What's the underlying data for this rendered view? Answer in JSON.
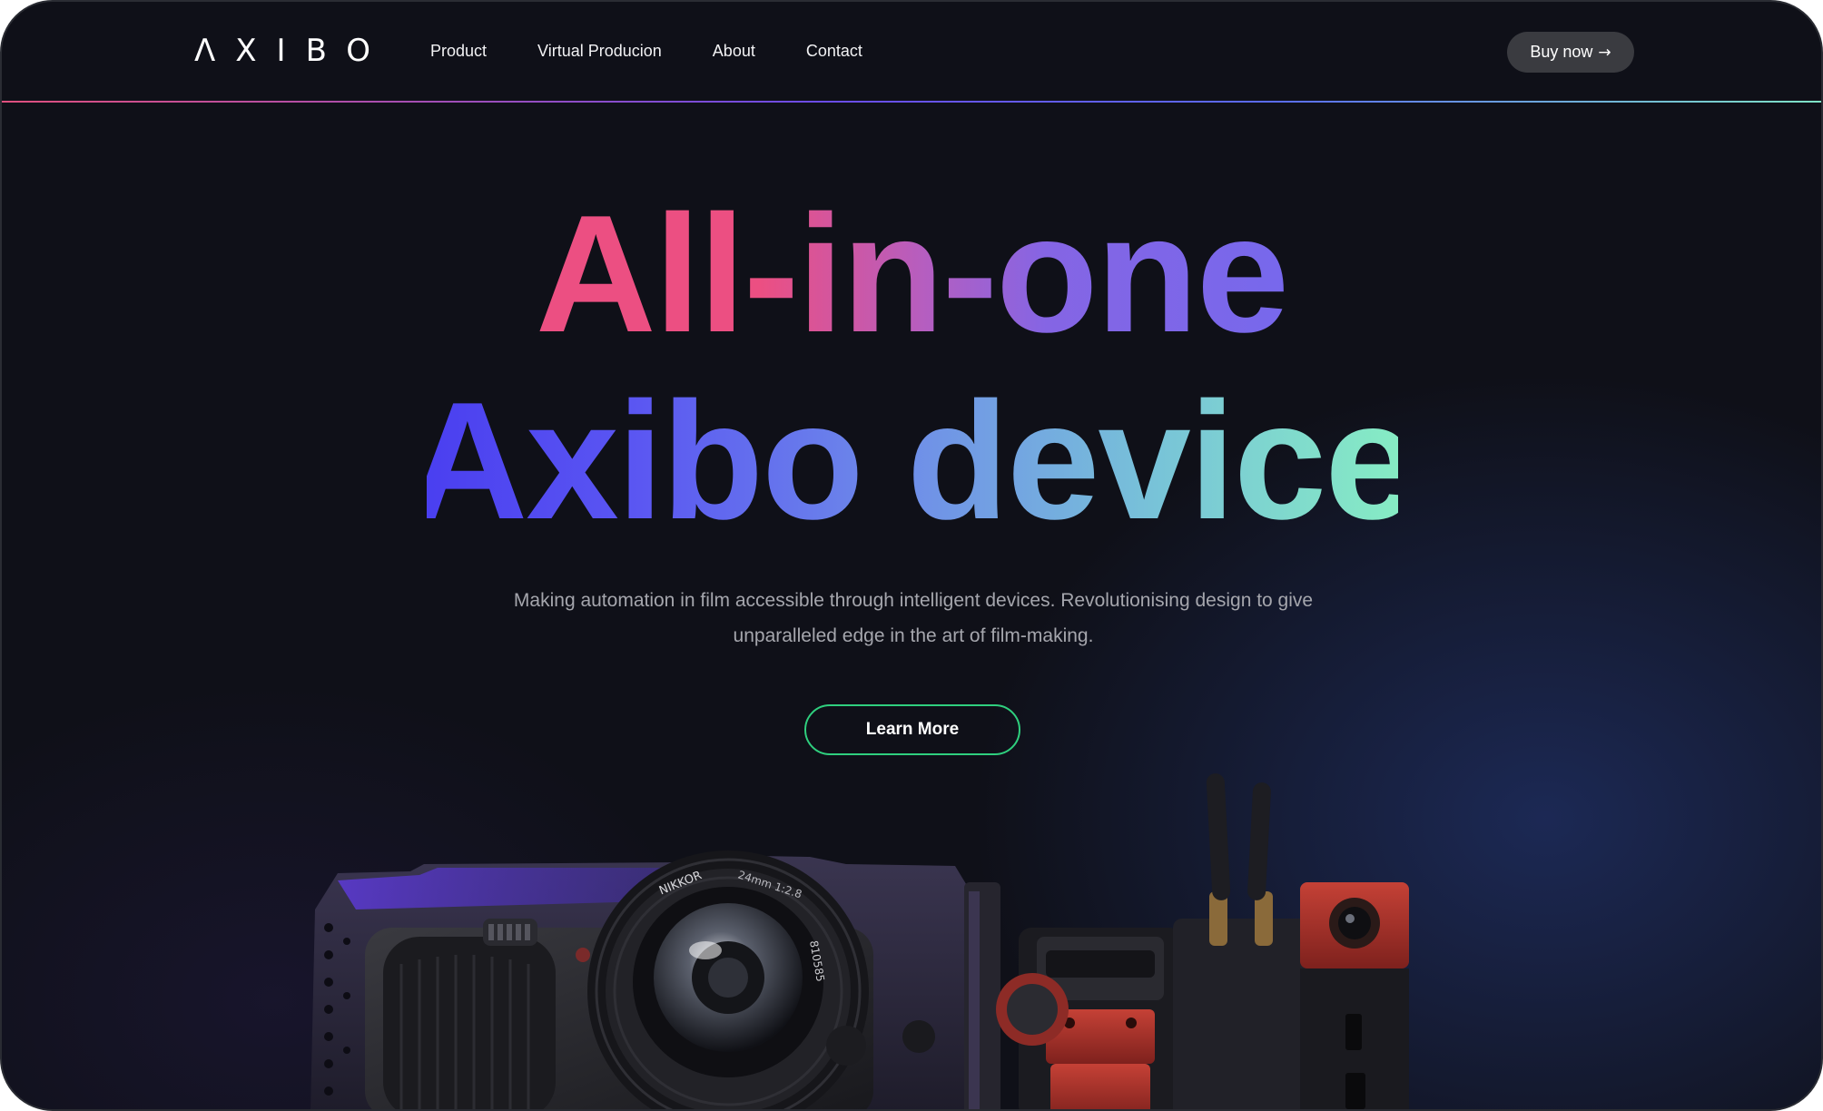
{
  "header": {
    "logo": "ΛXIBO",
    "nav": [
      "Product",
      "Virtual Producion",
      "About",
      "Contact"
    ],
    "buy_label": "Buy now",
    "buy_icon": "arrow-right-icon",
    "buy_arrow": "→"
  },
  "hero": {
    "line1": "All-in-one",
    "line2": "Axibo device",
    "subtitle_line1": "Making automation in film accessible through intelligent devices. Revolutionising design to give",
    "subtitle_line2": "unparalleled edge in the art of film-making.",
    "cta_label": "Learn More"
  },
  "camera": {
    "lens_brand": "NIKKOR",
    "lens_spec": "24mm 1:2.8",
    "lens_serial": "810585"
  },
  "colors": {
    "background": "#0f1018",
    "gradient_pink": "#ec4f82",
    "gradient_purple": "#7768ec",
    "gradient_blue": "#4a3ff0",
    "gradient_mint": "#86ecc4",
    "cta_border": "#2fcf7e",
    "buy_button_bg": "#3a3b40",
    "rig_accent_red": "#b7352f"
  }
}
